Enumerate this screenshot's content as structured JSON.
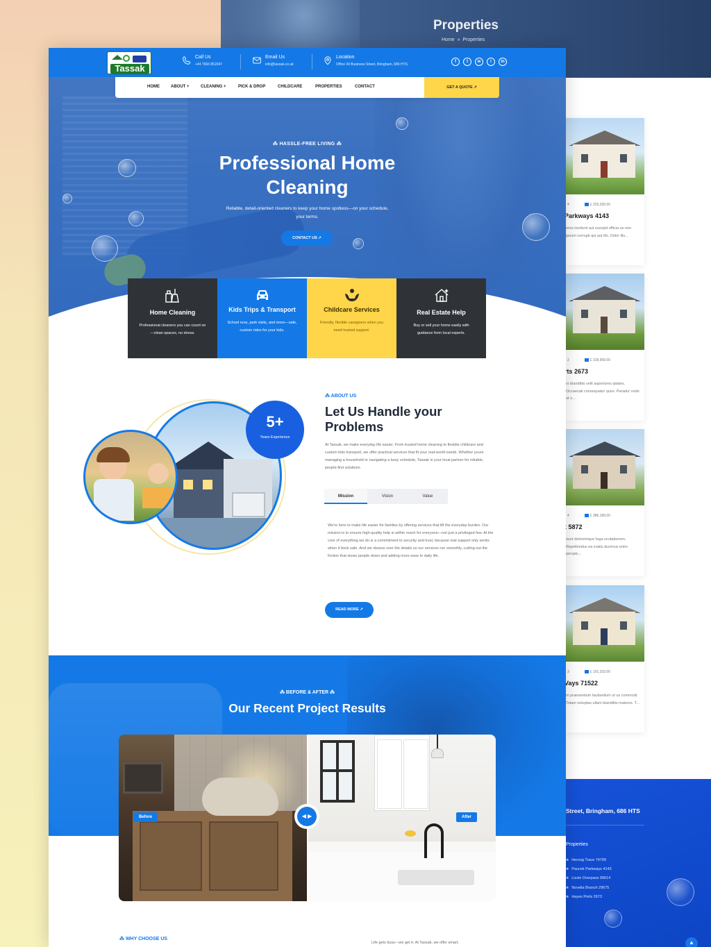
{
  "background": {
    "banner": {
      "title": "Properties",
      "breadcrumb": [
        "Home",
        "Properties"
      ]
    },
    "properties": [
      {
        "price": "£ 229,330.00",
        "beds": "4",
        "title": "Parkways 4143",
        "desc": "eres incidunt aut suscipit officia os non ipsum corrupti qui aut illo. Dolor illu..."
      },
      {
        "price": "£ 318,959.00",
        "beds": "2",
        "title": "rts 2673",
        "desc": "rs blanditiis velit asperiores iptates. Occaecati consequatur quos. Pariatur unde ut o..."
      },
      {
        "price": "£ 386,189.00",
        "beds": "4",
        "title": "t 5872",
        "desc": "ount doloremque fuga orcitationem. Repellendus ea iciatis ducimus enim perspic..."
      },
      {
        "price": "£ 191,333.00",
        "beds": "3",
        "title": "Vays 71522",
        "desc": "m praesentium laudantium ut us commodi. Totam voluptas ullam blanditiis maiores. T..."
      }
    ],
    "footer": {
      "address": "Street, Bringham, 686 HTS",
      "heading": "Properties",
      "links": [
        "Herzog Trace 74799",
        "Paucek Parkways 4143",
        "Lizzie Overpass 99614",
        "Novella Branch 29675",
        "Hayes Ports 2673"
      ]
    }
  },
  "topbar": {
    "logo_text": "Tassak",
    "call": {
      "label": "Call Us",
      "value": "+44 7666 852947"
    },
    "email": {
      "label": "Email Us",
      "value": "info@tassak.co.uk"
    },
    "location": {
      "label": "Location",
      "value": "Office 34 Business Street, Bringham, 686 HTS"
    },
    "social": [
      "f",
      "t",
      "w",
      "i",
      "in"
    ]
  },
  "nav": {
    "items": [
      "HOME",
      "ABOUT +",
      "CLEANING +",
      "PICK & DROP",
      "CHILDCARE",
      "PROPERTIES",
      "CONTACT"
    ],
    "cta": "GET A QUOTE ↗"
  },
  "hero": {
    "eyebrow": "⁂ HASSLE-FREE LIVING ⁂",
    "title": "Professional Home Cleaning",
    "subtitle": "Reliable, detail-oriented cleaners to keep your home spotless—on your schedule, your terms.",
    "button": "CONTACT US ↗"
  },
  "services": [
    {
      "title": "Home Cleaning",
      "desc": "Professional cleaners you can count on—clean spaces, no stress.",
      "icon": "cleaning-icon",
      "bg": "#2f3337",
      "fg": "#ffffff"
    },
    {
      "title": "Kids Trips & Transport",
      "desc": "School runs, park visits, and more—safe, custom rides for your kids.",
      "icon": "car-icon",
      "bg": "#1479e6",
      "fg": "#ffffff"
    },
    {
      "title": "Childcare Services",
      "desc": "Friendly, flexible caregivers when you need trusted support.",
      "icon": "childcare-icon",
      "bg": "#ffd54a",
      "fg": "#4a3a00"
    },
    {
      "title": "Real Estate Help",
      "desc": "Buy or sell your home easily with guidance from local experts.",
      "icon": "house-icon",
      "bg": "#2f3337",
      "fg": "#ffffff"
    }
  ],
  "about": {
    "experience_value": "5+",
    "experience_label": "Years Experience",
    "eyebrow": "⁂ ABOUT US",
    "title": "Let Us Handle your Problems",
    "text": "At Tassak, we make everyday life easier. From trusted home cleaning to flexible childcare and custom kids transport, we offer practical services that fit your real-world needs. Whether youre managing a household or navigating a busy schedule, Tassak is your local partner for reliable, people-first solutions.",
    "tabs": [
      "Mission",
      "Vision",
      "Value"
    ],
    "tab_text": "We're here to make life easier for families by offering services that lift the everyday burden. Our mission is to ensure high-quality help is within reach for everyone—not just a privileged few. At the core of everything we do is a commitment to security and trust, because real support only works when it feels safe. And we obsess over the details so our services run smoothly, cutting out the friction that slows people down and adding more ease to daily life.",
    "button": "READ MORE ↗"
  },
  "projects": {
    "eyebrow": "⁂ BEFORE & AFTER ⁂",
    "title": "Our Recent Project Results",
    "before_label": "Before",
    "after_label": "After",
    "handle": "◀ ▶"
  },
  "why": {
    "eyebrow": "⁂ WHY CHOOSE US",
    "text": "Life gets busy—we get it. At Tassak, we offer smart,"
  },
  "colors": {
    "primary": "#1479e6",
    "accent": "#ffd54a",
    "dark": "#2f3337"
  }
}
